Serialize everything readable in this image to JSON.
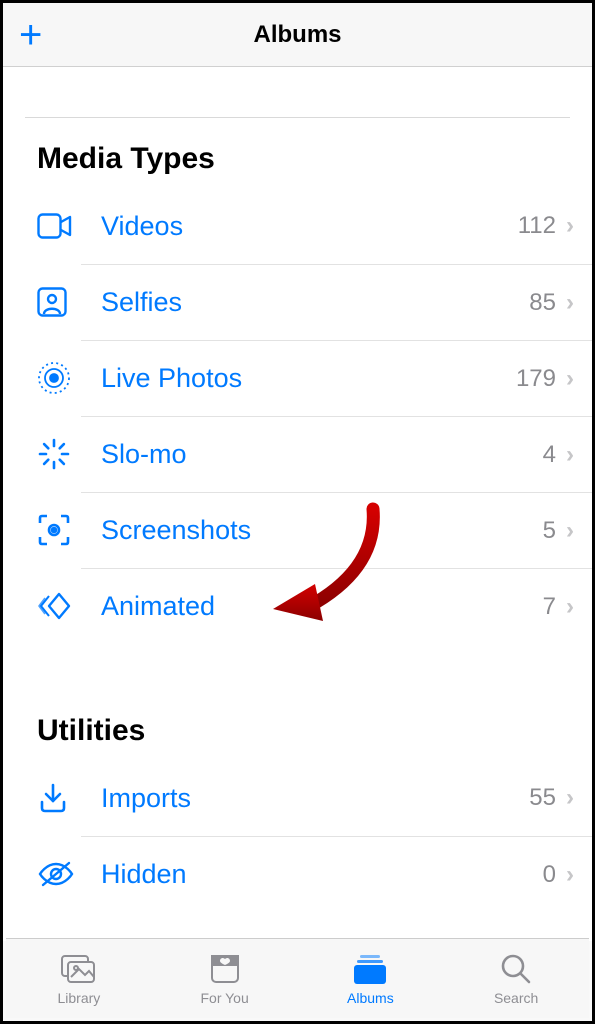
{
  "header": {
    "title": "Albums",
    "add_action": "+"
  },
  "sections": {
    "media_types": {
      "title": "Media Types",
      "items": [
        {
          "icon": "video-icon",
          "label": "Videos",
          "count": "112"
        },
        {
          "icon": "selfie-icon",
          "label": "Selfies",
          "count": "85"
        },
        {
          "icon": "livephoto-icon",
          "label": "Live Photos",
          "count": "179"
        },
        {
          "icon": "slomo-icon",
          "label": "Slo-mo",
          "count": "4"
        },
        {
          "icon": "screenshot-icon",
          "label": "Screenshots",
          "count": "5"
        },
        {
          "icon": "animated-icon",
          "label": "Animated",
          "count": "7"
        }
      ]
    },
    "utilities": {
      "title": "Utilities",
      "items": [
        {
          "icon": "import-icon",
          "label": "Imports",
          "count": "55"
        },
        {
          "icon": "hidden-icon",
          "label": "Hidden",
          "count": "0"
        }
      ]
    }
  },
  "tabs": [
    {
      "label": "Library",
      "active": false
    },
    {
      "label": "For You",
      "active": false
    },
    {
      "label": "Albums",
      "active": true
    },
    {
      "label": "Search",
      "active": false
    }
  ],
  "annotation": {
    "target_row": "Animated",
    "glyph": "curved-red-arrow"
  }
}
